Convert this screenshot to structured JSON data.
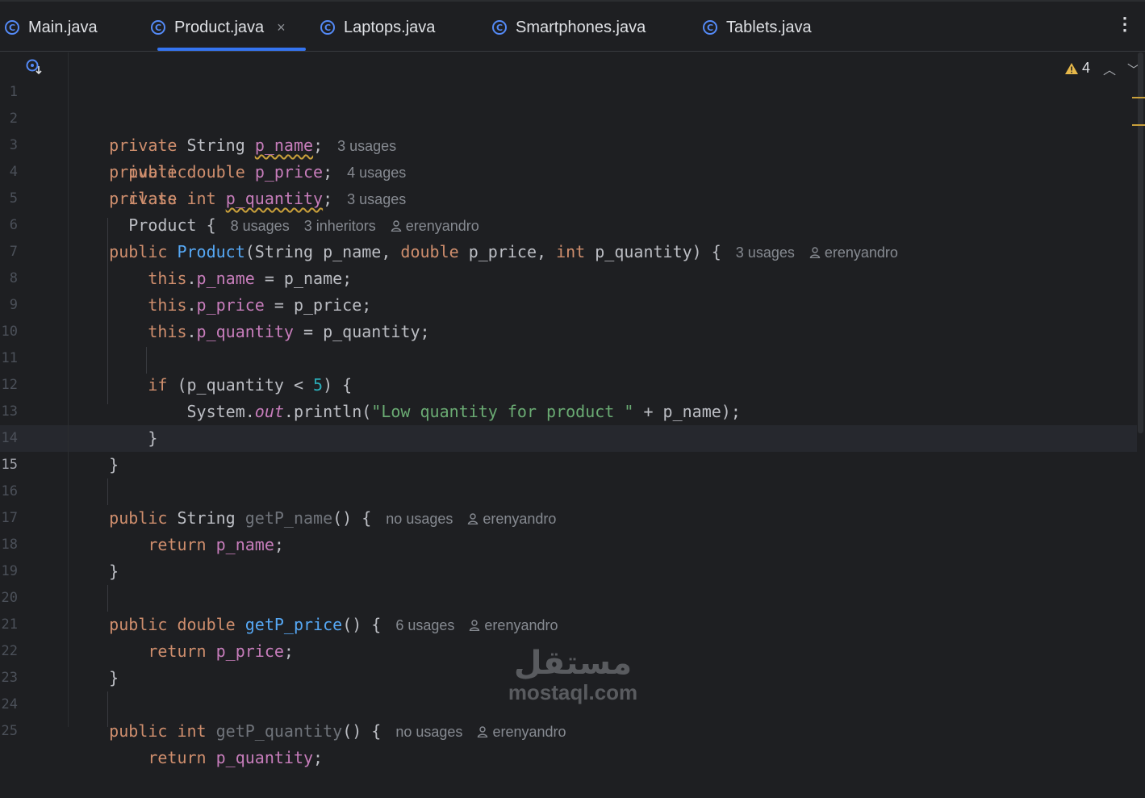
{
  "tabs": [
    {
      "label": "Main.java",
      "icon": "class-run-icon"
    },
    {
      "label": "Product.java",
      "icon": "class-icon",
      "active": true,
      "close": "×"
    },
    {
      "label": "Laptops.java",
      "icon": "class-icon"
    },
    {
      "label": "Smartphones.java",
      "icon": "class-icon"
    },
    {
      "label": "Tablets.java",
      "icon": "class-icon"
    }
  ],
  "more_menu": "⋮",
  "warnings": {
    "count": "4",
    "up": "︿",
    "down": "﹀"
  },
  "line_numbers": [
    "1",
    "2",
    "3",
    "4",
    "5",
    "6",
    "7",
    "8",
    "9",
    "10",
    "11",
    "12",
    "13",
    "14",
    "15",
    "16",
    "17",
    "18",
    "19",
    "20",
    "21",
    "22",
    "23",
    "24",
    "25"
  ],
  "current_line": "15",
  "code": {
    "l1": {
      "kw1": "public",
      "kw2": "class",
      "name": "Product",
      "brace": " {",
      "hint1": "8 usages",
      "hint2": "3 inheritors",
      "author": "erenyandro"
    },
    "l2": {
      "kw": "private",
      "type": "String",
      "field": "p_name",
      "semi": ";",
      "hint": "3 usages"
    },
    "l3": {
      "kw1": "private",
      "kw2": "double",
      "field": "p_price",
      "semi": ";",
      "hint": "4 usages"
    },
    "l4": {
      "kw1": "private",
      "kw2": "int",
      "field": "p_quantity",
      "semi": ";",
      "hint": "3 usages"
    },
    "l6": {
      "kw": "public",
      "name": "Product",
      "p1": "(String p_name, ",
      "kw2": "double",
      "p2": " p_price, ",
      "kw3": "int",
      "p3": " p_quantity) {",
      "hint": "3 usages",
      "author": "erenyandro"
    },
    "l7": {
      "this": "this",
      "dot": ".",
      "field": "p_name",
      "rest": " = p_name;"
    },
    "l8": {
      "this": "this",
      "dot": ".",
      "field": "p_price",
      "rest": " = p_price;"
    },
    "l9": {
      "this": "this",
      "dot": ".",
      "field": "p_quantity",
      "rest": " = p_quantity;"
    },
    "l11": {
      "kw": "if",
      "p1": " (p_quantity < ",
      "num": "5",
      "p2": ") {"
    },
    "l12": {
      "sys": "System.",
      "out": "out",
      "call": ".println(",
      "str": "\"Low quantity for product \"",
      "rest": " + p_name);"
    },
    "l13": {
      "brace": "}"
    },
    "l14": {
      "brace": "}"
    },
    "l16": {
      "kw": "public",
      "type": " String ",
      "name": "getP_name",
      "rest": "() {",
      "hint": "no usages",
      "author": "erenyandro"
    },
    "l17": {
      "kw": "return",
      "field": "p_name",
      "semi": ";"
    },
    "l18": {
      "brace": "}"
    },
    "l20": {
      "kw1": "public",
      "kw2": "double",
      "name": "getP_price",
      "rest": "() {",
      "hint": "6 usages",
      "author": "erenyandro"
    },
    "l21": {
      "kw": "return",
      "field": "p_price",
      "semi": ";"
    },
    "l22": {
      "brace": "}"
    },
    "l24": {
      "kw1": "public",
      "kw2": "int",
      "name": "getP_quantity",
      "rest": "() {",
      "hint": "no usages",
      "author": "erenyandro"
    },
    "l25": {
      "kw": "return",
      "field": "p_quantity",
      "semi": ";"
    }
  },
  "watermark": {
    "arabic": "مستقل",
    "latin": "mostaql.com"
  },
  "colors": {
    "keyword": "#cf8e6d",
    "field": "#c77dbb",
    "function": "#56a8f5",
    "string": "#6aab73",
    "number": "#2aacb8",
    "accent": "#3574f0",
    "warning": "#c9a03b"
  }
}
